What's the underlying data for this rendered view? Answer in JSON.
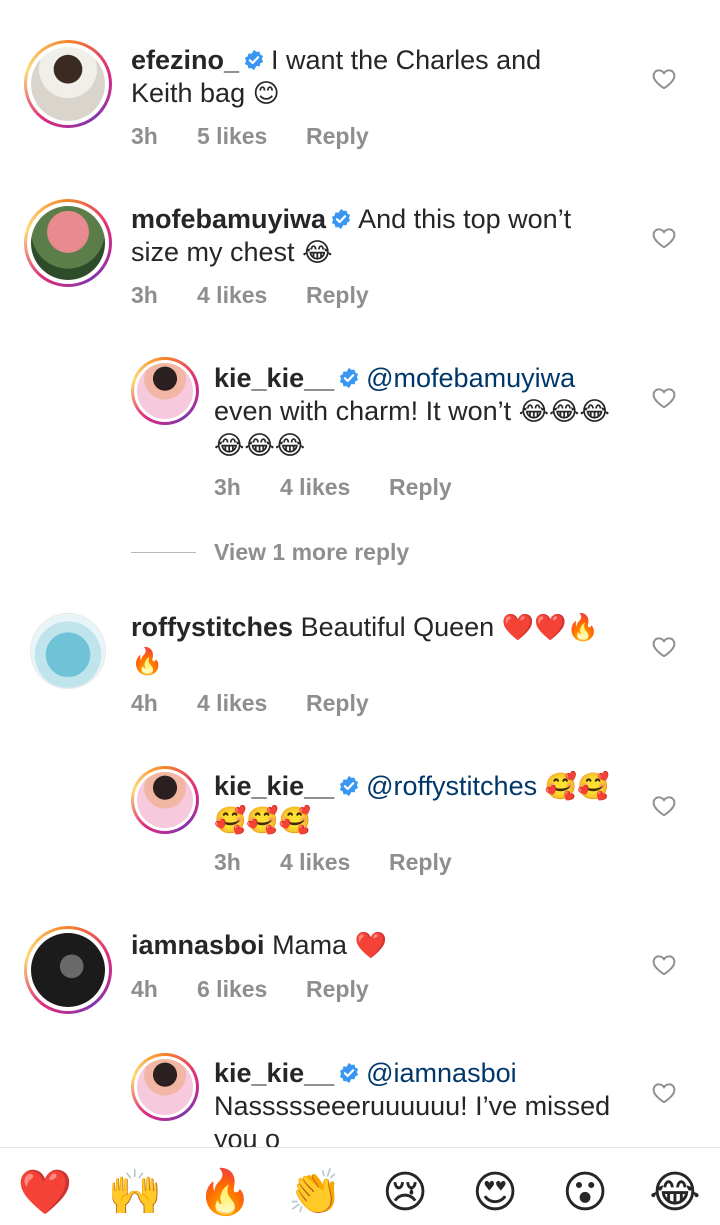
{
  "comments": [
    {
      "username": "efezino_",
      "verified": true,
      "text": "I want the Charles and Keith bag",
      "emoji": "😊",
      "time": "3h",
      "likes": "5 likes",
      "reply_label": "Reply"
    },
    {
      "username": "mofebamuyiwa",
      "verified": true,
      "text": "And this top won’t size my chest",
      "emoji": "😂",
      "time": "3h",
      "likes": "4 likes",
      "reply_label": "Reply"
    },
    {
      "username": "kie_kie__",
      "verified": true,
      "mention": "@mofebamuyiwa",
      "text": "even with charm! It won’t",
      "emoji": "😂😂😂😂😂😂",
      "time": "3h",
      "likes": "4 likes",
      "reply_label": "Reply"
    },
    {
      "username": "roffystitches",
      "verified": false,
      "text": "Beautiful Queen",
      "emoji": "❤️❤️🔥🔥",
      "time": "4h",
      "likes": "4 likes",
      "reply_label": "Reply"
    },
    {
      "username": "kie_kie__",
      "verified": true,
      "mention": "@roffystitches",
      "text": "",
      "emoji": "🥰🥰🥰🥰🥰",
      "time": "3h",
      "likes": "4 likes",
      "reply_label": "Reply"
    },
    {
      "username": "iamnasboi",
      "verified": false,
      "text": "Mama",
      "emoji": "❤️",
      "time": "4h",
      "likes": "6 likes",
      "reply_label": "Reply"
    },
    {
      "username": "kie_kie__",
      "verified": true,
      "mention": "@iamnasboi",
      "text": "Nassssseeeruuuuuu! I’ve missed you o",
      "emoji": ""
    }
  ],
  "view_more_replies": "View 1 more reply",
  "quick_reactions": [
    "❤️",
    "🙌",
    "🔥",
    "👏",
    "😢",
    "😍",
    "😮",
    "😂"
  ],
  "colors": {
    "verified": "#3897f0",
    "mention": "#00376b",
    "meta": "#8e8e8e"
  }
}
